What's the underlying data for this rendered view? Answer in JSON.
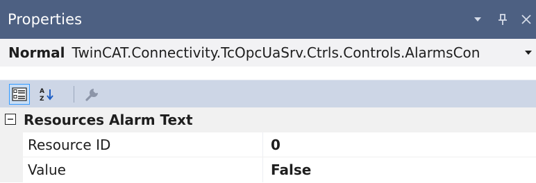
{
  "window": {
    "title": "Properties",
    "dropdown_icon": "triangle-down-icon",
    "pin_icon": "pin-icon",
    "close_icon": "close-icon",
    "pin_glyph": "ᛘ",
    "close_glyph": "✕"
  },
  "selector": {
    "object_name": "Normal",
    "object_type": "TwinCAT.Connectivity.TcOpcUaSrv.Ctrls.Controls.AlarmsCon",
    "arrow_glyph": "▾"
  },
  "toolbar": {
    "categorized_icon": "categorized-icon",
    "alphabetical_icon": "sort-alphabetical-icon",
    "property_pages_icon": "wrench-icon",
    "sort_glyph": "A/Z↓"
  },
  "grid": {
    "category": {
      "label": "Resources Alarm Text",
      "expanded": true,
      "expander_glyph": "−"
    },
    "properties": [
      {
        "name": "Resource ID",
        "value": "0"
      },
      {
        "name": "Value",
        "value": "False"
      }
    ]
  },
  "colors": {
    "titlebar": "#4d6082",
    "toolbar": "#cdd6e6",
    "gutter": "#f1f1f1",
    "accent": "#3399ff"
  }
}
